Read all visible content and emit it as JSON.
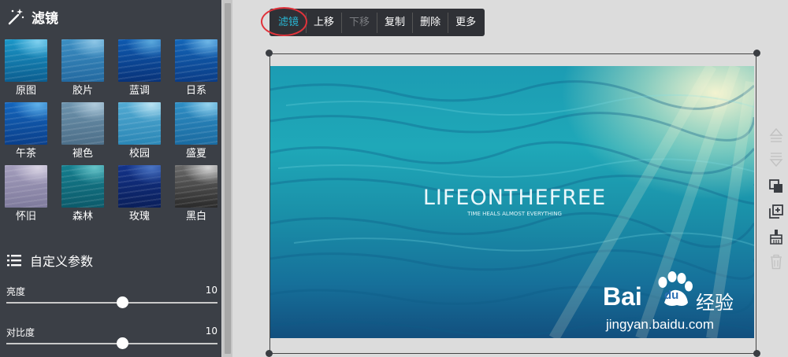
{
  "panel": {
    "title": "滤镜",
    "custom_title": "自定义参数"
  },
  "filters": [
    {
      "label": "原图",
      "colors": [
        "#0b5d8f",
        "#1b97c8",
        "#7fd0ef"
      ]
    },
    {
      "label": "胶片",
      "colors": [
        "#2369a0",
        "#3c8fc3",
        "#8ec6e6"
      ]
    },
    {
      "label": "蓝调",
      "colors": [
        "#08337a",
        "#0e5ab0",
        "#5aa8dc"
      ]
    },
    {
      "label": "日系",
      "colors": [
        "#0a3c86",
        "#1366b8",
        "#6eb6e6"
      ]
    },
    {
      "label": "午茶",
      "colors": [
        "#0a3f8a",
        "#1466bd",
        "#5fb0e8"
      ]
    },
    {
      "label": "褪色",
      "colors": [
        "#4c6e88",
        "#6d93ad",
        "#b0cadb"
      ]
    },
    {
      "label": "校园",
      "colors": [
        "#2a86b5",
        "#53abd3",
        "#b9e2f2"
      ]
    },
    {
      "label": "盛夏",
      "colors": [
        "#1a6aa0",
        "#2f8ec4",
        "#95d3ee"
      ]
    },
    {
      "label": "怀旧",
      "colors": [
        "#7e7a9c",
        "#a49ebd",
        "#d9d4e4"
      ]
    },
    {
      "label": "森林",
      "colors": [
        "#0c5a6a",
        "#157f8f",
        "#66c3c8"
      ]
    },
    {
      "label": "玫瑰",
      "colors": [
        "#0a1f5a",
        "#13338a",
        "#4a74c2"
      ]
    },
    {
      "label": "黑白",
      "colors": [
        "#2a2a2a",
        "#6a6a6a",
        "#d4d4d4"
      ]
    }
  ],
  "sliders": [
    {
      "label": "亮度",
      "value": "10",
      "fraction": 0.55
    },
    {
      "label": "对比度",
      "value": "10",
      "fraction": 0.55
    }
  ],
  "toolbar": {
    "filter": "滤镜",
    "move_up": "上移",
    "move_down": "下移",
    "copy": "复制",
    "delete": "删除",
    "more": "更多"
  },
  "photo": {
    "headline": "LIFEONTHEFREE",
    "subline": "TIME HEALS ALMOST EVERYTHING"
  },
  "watermark": {
    "brand": "Bai",
    "brand_suffix": "du",
    "brand_cn": "经验",
    "url": "jingyan.baidu.com"
  },
  "colors": {
    "panel_bg": "#3b3f46",
    "accent": "#28b8d5",
    "highlight": "#e0333b"
  }
}
